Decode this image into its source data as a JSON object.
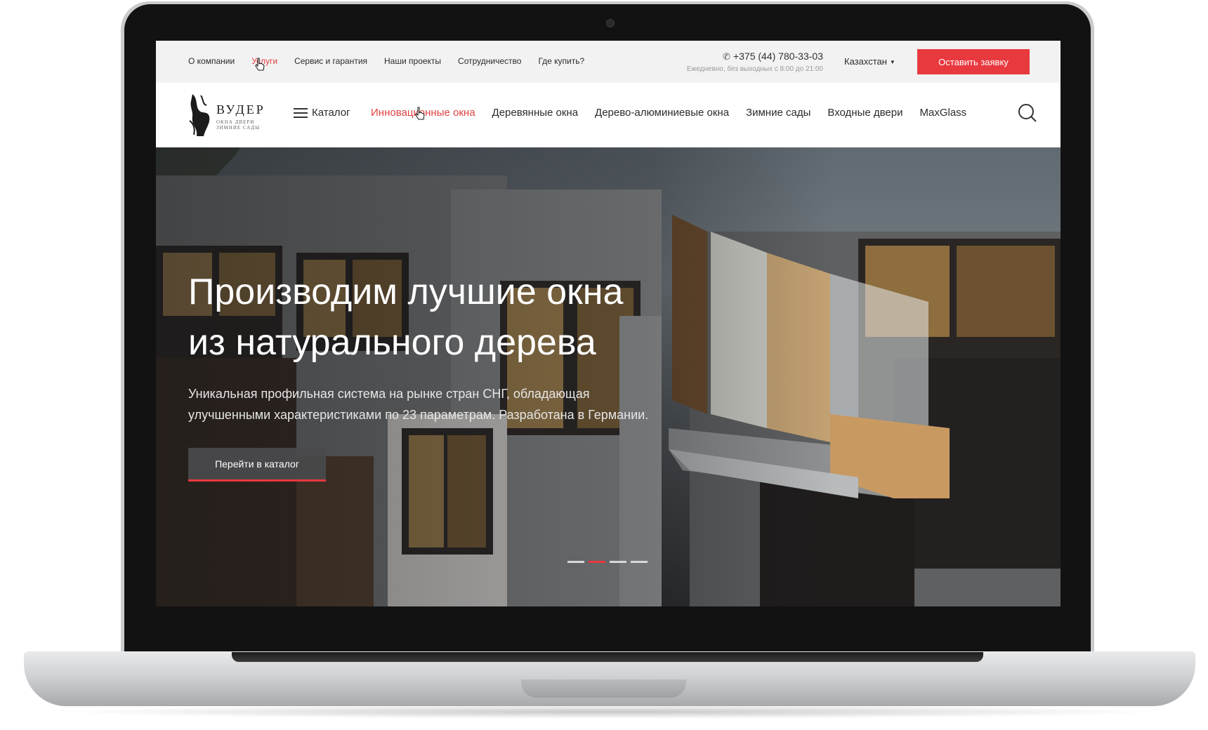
{
  "top_nav": {
    "items": [
      {
        "label": "О компании",
        "active": false
      },
      {
        "label": "Услуги",
        "active": true
      },
      {
        "label": "Сервис и гарантия",
        "active": false
      },
      {
        "label": "Наши проекты",
        "active": false
      },
      {
        "label": "Сотрудничество",
        "active": false
      },
      {
        "label": "Где купить?",
        "active": false
      }
    ]
  },
  "contact": {
    "phone": "+375 (44) 780-33-03",
    "hours": "Ежедневно, без выходных с 8:00 до 21:00",
    "phone_icon": "phone-icon"
  },
  "country_select": {
    "value": "Казахстан"
  },
  "header_cta": {
    "label": "Оставить заявку"
  },
  "logo": {
    "name": "ВУДЕР",
    "tagline": "ОКНА ДВЕРИ ЗИМНИЕ САДЫ"
  },
  "catalog": {
    "label": "Каталог",
    "icon": "menu-icon"
  },
  "main_nav": {
    "items": [
      {
        "label": "Инновационные окна",
        "active": true
      },
      {
        "label": "Деревянные окна",
        "active": false
      },
      {
        "label": "Дерево-алюминиевые окна",
        "active": false
      },
      {
        "label": "Зимние сады",
        "active": false
      },
      {
        "label": "Входные двери",
        "active": false
      },
      {
        "label": "MaxGlass",
        "active": false
      }
    ]
  },
  "search": {
    "icon": "search-icon"
  },
  "hero": {
    "title_line1": "Производим лучшие окна",
    "title_line2": "из натурального дерева",
    "subtitle_line1": "Уникальная профильная система на рынке стран СНГ, обладающая",
    "subtitle_line2": "улучшенными характеристиками по 23 параметрам. Разработана в Германии.",
    "cta_label": "Перейти в каталог",
    "slides_total": 4,
    "active_slide": 2
  },
  "colors": {
    "accent": "#e8393f",
    "top_bar_bg": "#f2f2f2",
    "text": "#2b2b2b"
  }
}
